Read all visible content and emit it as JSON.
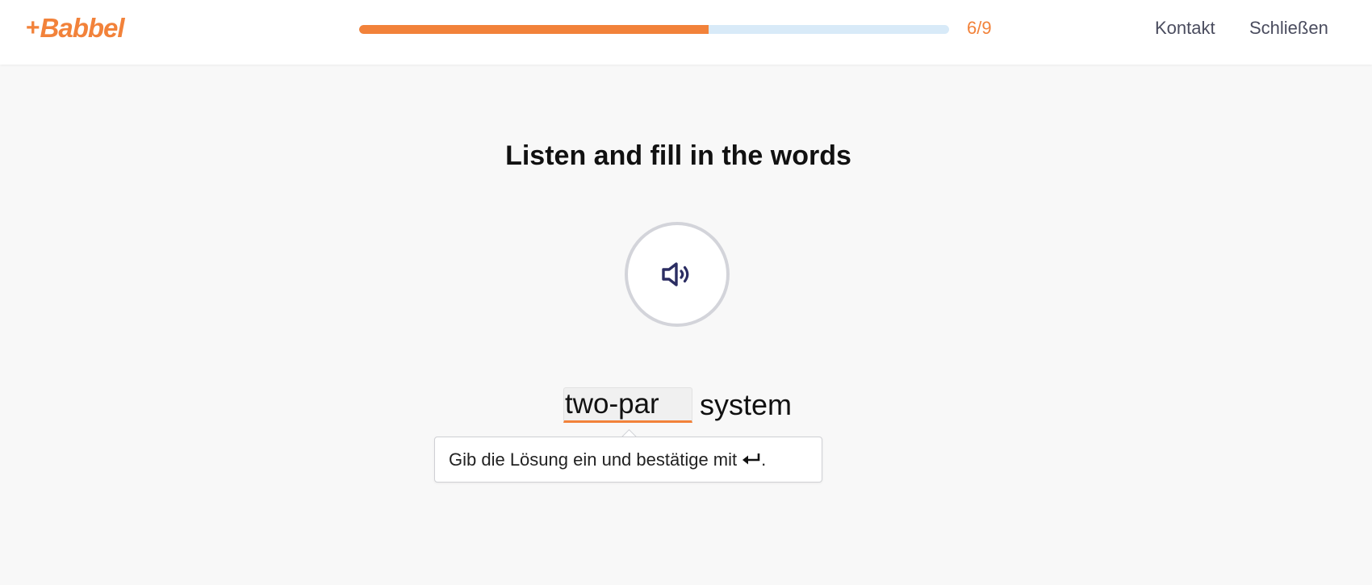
{
  "header": {
    "logo_plus": "+",
    "logo_text": "Babbel",
    "progress": {
      "fraction": 0.593,
      "count_label": "6/9"
    },
    "nav": {
      "contact_label": "Kontakt",
      "close_label": "Schließen"
    }
  },
  "exercise": {
    "instruction": "Listen and fill in the words",
    "audio_icon": "speaker-icon",
    "answer_value": "two-par",
    "sentence_rest": "system",
    "tooltip_text": "Gib die Lösung ein und bestätige mit",
    "tooltip_end": ".",
    "tooltip_icon": "enter-key-icon"
  },
  "colors": {
    "accent": "#f2823a",
    "progress_track": "#d8eaf8",
    "icon": "#2b2d62",
    "background": "#f8f8f8"
  }
}
